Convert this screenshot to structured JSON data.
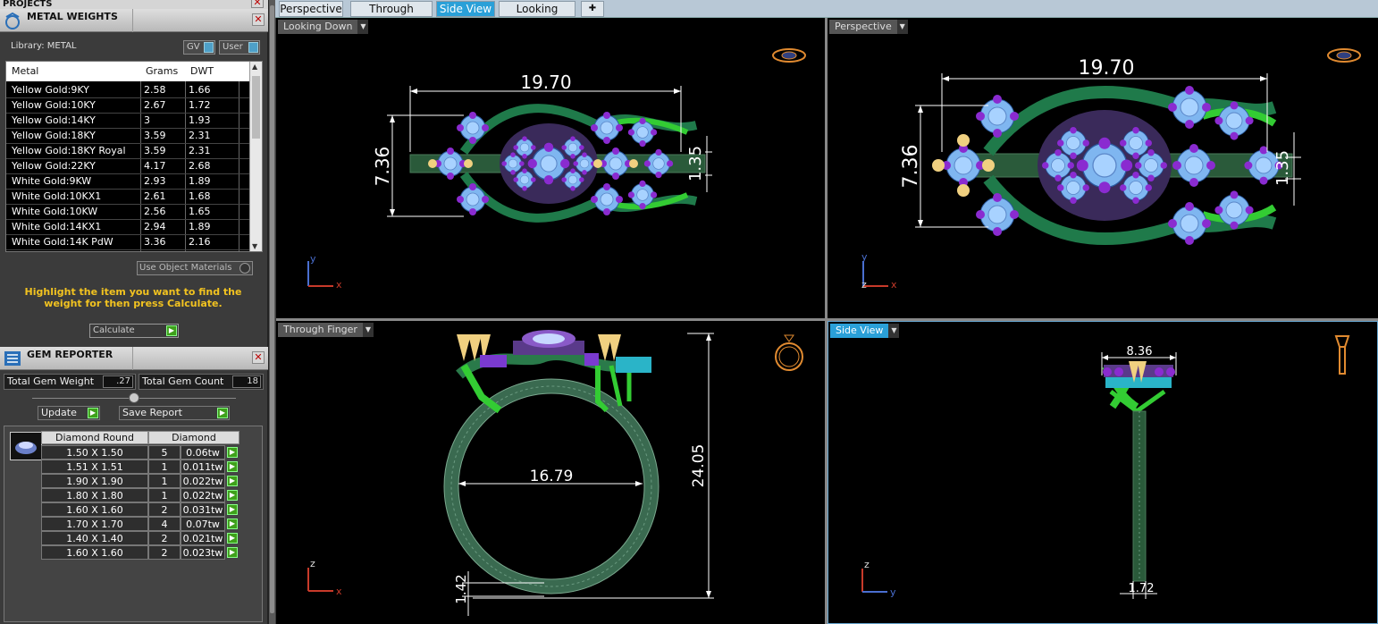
{
  "projects_label": "PROJECTS",
  "metal_weights": {
    "title": "METAL WEIGHTS",
    "library_label": "Library: METAL",
    "gv_label": "GV",
    "user_label": "User",
    "columns": [
      "Metal",
      "Grams",
      "DWT"
    ],
    "rows": [
      [
        "Yellow Gold:9KY",
        "2.58",
        "1.66"
      ],
      [
        "Yellow Gold:10KY",
        "2.67",
        "1.72"
      ],
      [
        "Yellow Gold:14KY",
        "3",
        "1.93"
      ],
      [
        "Yellow Gold:18KY",
        "3.59",
        "2.31"
      ],
      [
        "Yellow Gold:18KY Royal",
        "3.59",
        "2.31"
      ],
      [
        "Yellow Gold:22KY",
        "4.17",
        "2.68"
      ],
      [
        "White Gold:9KW",
        "2.93",
        "1.89"
      ],
      [
        "White Gold:10KX1",
        "2.61",
        "1.68"
      ],
      [
        "White Gold:10KW",
        "2.56",
        "1.65"
      ],
      [
        "White Gold:14KX1",
        "2.94",
        "1.89"
      ],
      [
        "White Gold:14K PdW",
        "3.36",
        "2.16"
      ]
    ],
    "use_object_materials": "Use Object Materials",
    "hint": "Highlight the item you want to find the weight for then press Calculate.",
    "calculate_label": "Calculate"
  },
  "gem_reporter": {
    "title": "GEM REPORTER",
    "total_weight_label": "Total Gem Weight",
    "total_weight_value": ".27",
    "total_count_label": "Total Gem Count",
    "total_count_value": "18",
    "update_label": "Update",
    "save_report_label": "Save Report",
    "header_shape": "Diamond Round",
    "header_material": "Diamond",
    "rows": [
      [
        "1.50 X 1.50",
        "5",
        "0.06tw"
      ],
      [
        "1.51 X 1.51",
        "1",
        "0.011tw"
      ],
      [
        "1.90 X 1.90",
        "1",
        "0.022tw"
      ],
      [
        "1.80 X 1.80",
        "1",
        "0.022tw"
      ],
      [
        "1.60 X 1.60",
        "2",
        "0.031tw"
      ],
      [
        "1.70 X 1.70",
        "4",
        "0.07tw"
      ],
      [
        "1.40 X 1.40",
        "2",
        "0.021tw"
      ],
      [
        "1.60 X 1.60",
        "2",
        "0.023tw"
      ]
    ]
  },
  "tabs": [
    "Perspective",
    "Through Finger",
    "Side View",
    "Looking Down",
    "+"
  ],
  "active_tab": "Side View",
  "viewports": {
    "looking_down": {
      "label": "Looking Down",
      "dim_width": "19.70",
      "dim_height": "7.36",
      "dim_small": "1.35"
    },
    "perspective": {
      "label": "Perspective",
      "dim_width": "19.70",
      "dim_height": "7.36",
      "dim_small": "1.35"
    },
    "through_finger": {
      "label": "Through Finger",
      "dim_inner": "16.79",
      "dim_height": "24.05",
      "dim_shank": "1.42"
    },
    "side_view": {
      "label": "Side View",
      "dim_top": "8.36",
      "dim_bottom": "1.72"
    }
  },
  "axes": {
    "x": "x",
    "y": "y",
    "z": "z"
  },
  "colors": {
    "accent": "#2aa0d8",
    "hint": "#f2c320",
    "metal": "#2a8a55",
    "gem": "#7fb6f0",
    "prong": "#8a2bd0"
  }
}
